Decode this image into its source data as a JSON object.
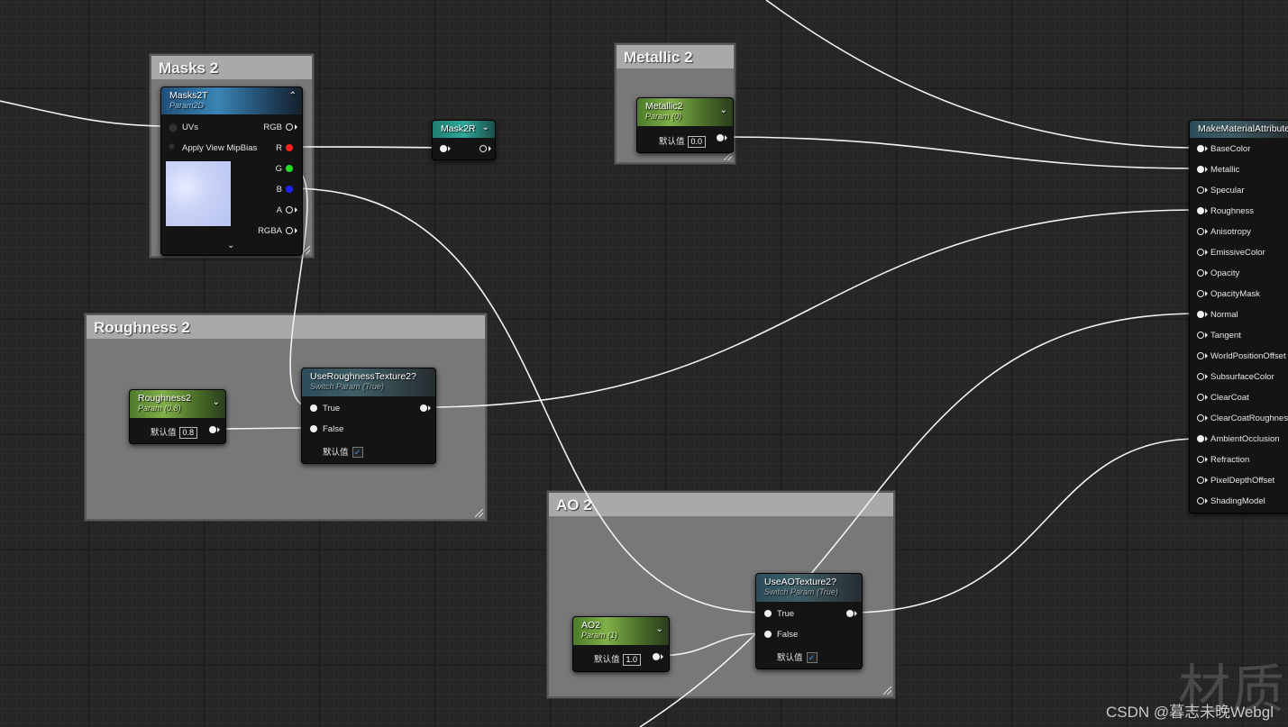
{
  "comments": {
    "masks": "Masks 2",
    "metallic": "Metallic 2",
    "roughness": "Roughness 2",
    "ao": "AO 2"
  },
  "masks_node": {
    "title": "Masks2T",
    "subtitle": "Param2D",
    "inputs": [
      "UVs",
      "Apply View MipBias"
    ],
    "outputs": [
      "RGB",
      "R",
      "G",
      "B",
      "A",
      "RGBA"
    ],
    "output_colors": {
      "R": "#ff2020",
      "G": "#20e020",
      "B": "#2020ff"
    }
  },
  "mask2r_node": {
    "title": "Mask2R"
  },
  "metallic_node": {
    "title": "Metallic2",
    "subtitle": "Param (0)",
    "default_label": "默认值",
    "default_value": "0.0"
  },
  "roughness_node": {
    "title": "Roughness2",
    "subtitle": "Param (0.8)",
    "default_label": "默认值",
    "default_value": "0.8"
  },
  "use_roughness_node": {
    "title": "UseRoughnessTexture2?",
    "subtitle": "Switch Param (True)",
    "true_label": "True",
    "false_label": "False",
    "default_label": "默认值",
    "default_checked": true
  },
  "ao_node": {
    "title": "AO2",
    "subtitle": "Param (1)",
    "default_label": "默认值",
    "default_value": "1.0"
  },
  "use_ao_node": {
    "title": "UseAOTexture2?",
    "subtitle": "Switch Param (True)",
    "true_label": "True",
    "false_label": "False",
    "default_label": "默认值",
    "default_checked": true
  },
  "make_material_node": {
    "title": "MakeMaterialAttributes",
    "inputs": [
      "BaseColor",
      "Metallic",
      "Specular",
      "Roughness",
      "Anisotropy",
      "EmissiveColor",
      "Opacity",
      "OpacityMask",
      "Normal",
      "Tangent",
      "WorldPositionOffset",
      "SubsurfaceColor",
      "ClearCoat",
      "ClearCoatRoughness",
      "AmbientOcclusion",
      "Refraction",
      "PixelDepthOffset",
      "ShadingModel"
    ],
    "connected": [
      "BaseColor",
      "Metallic",
      "Roughness",
      "Normal",
      "AmbientOcclusion"
    ]
  },
  "watermark": {
    "big": "材质",
    "small": "CSDN @暮志未晚Webgl"
  },
  "colors": {
    "grid_bg": "#262626",
    "comment_bg": "#787878",
    "wire": "#f2f2f2",
    "param_header": "#80b048",
    "texture_header": "#3a85b5"
  }
}
